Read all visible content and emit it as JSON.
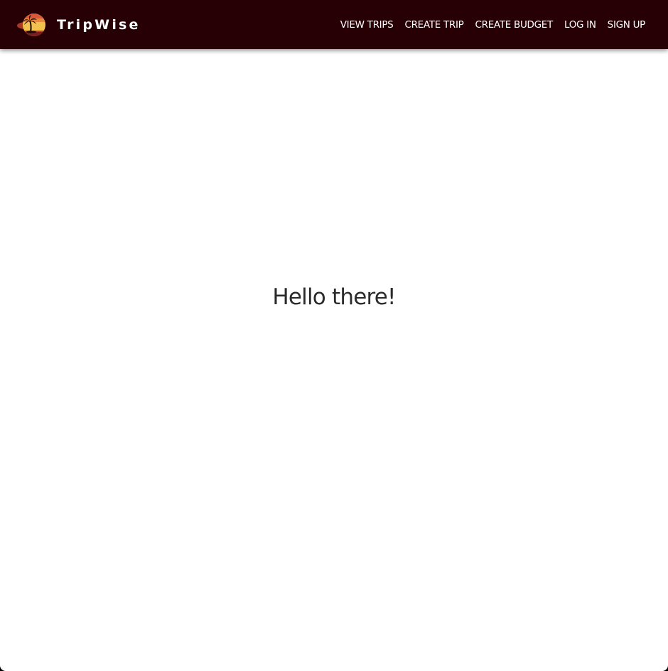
{
  "header": {
    "brand_name": "TripWise",
    "logo_icon": "palm-sunset-logo-icon",
    "nav_items": [
      {
        "label": "VIEW TRIPS"
      },
      {
        "label": "CREATE TRIP"
      },
      {
        "label": "CREATE BUDGET"
      },
      {
        "label": "LOG IN"
      },
      {
        "label": "SIGN UP"
      }
    ]
  },
  "main": {
    "greeting": "Hello there!"
  },
  "colors": {
    "navbar_background": "#260005",
    "nav_text": "#ffffff",
    "page_background": "#ffffff",
    "greeting_text": "#2b2b2b",
    "logo_sun": "#f3c14e",
    "logo_sky": "#d8583a"
  }
}
